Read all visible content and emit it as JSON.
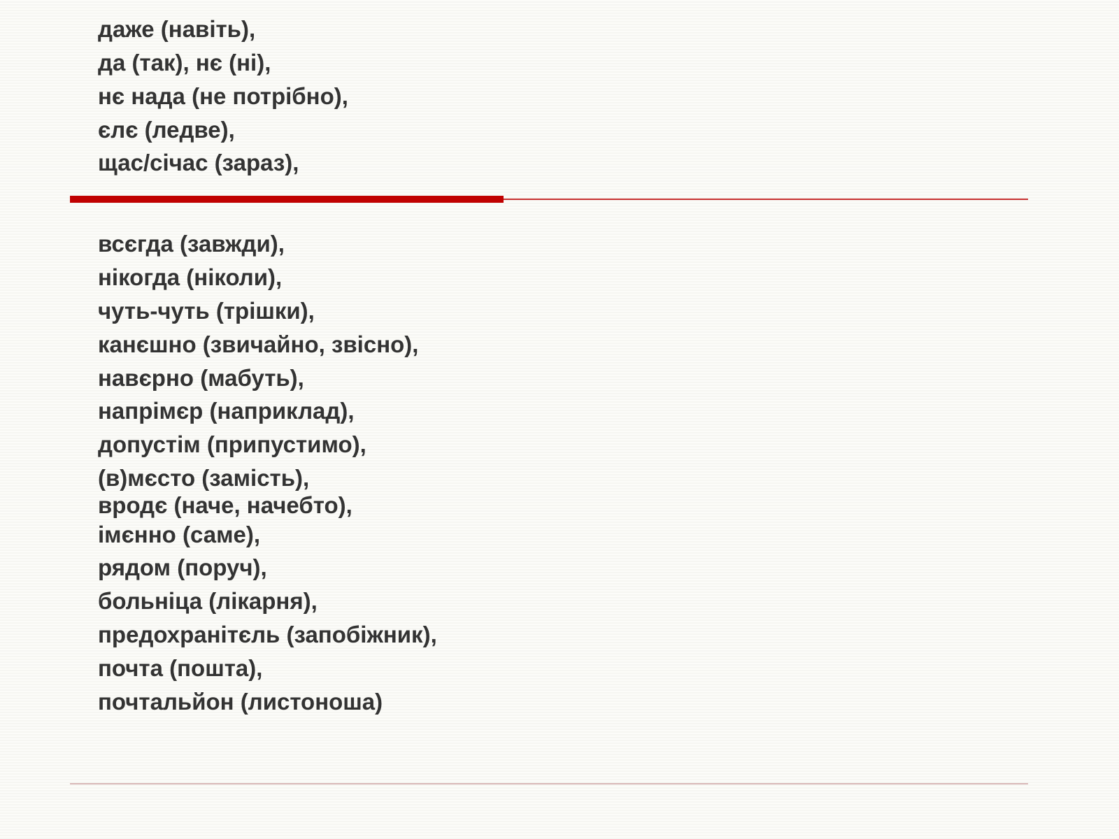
{
  "topBlock": [
    "даже (навіть),",
    "да (так), нє (ні),",
    "нє нада (не потрібно),",
    "єлє (ледве),",
    "щас/січас (зараз),"
  ],
  "bottomBlock": [
    "всєгда (завжди),",
    "нікогда (ніколи),",
    "чуть-чуть (трішки),",
    "канєшно (звичайно, звісно),",
    "навєрно (мабуть),",
    "напрімєр (наприклад),",
    "допустім (припустимо),",
    "(в)мєсто (замість),"
  ],
  "bottomBlockTight": [
    "вродє (наче, начебто),"
  ],
  "bottomBlockRest": [
    "імєнно (саме),",
    "рядом (поруч),",
    "больніца (лікарня),",
    "предохранітєль (запобіжник),",
    "почта (пошта),",
    "почтальйон (листоноша)"
  ],
  "colors": {
    "accent": "#c00000",
    "text": "#333333"
  }
}
